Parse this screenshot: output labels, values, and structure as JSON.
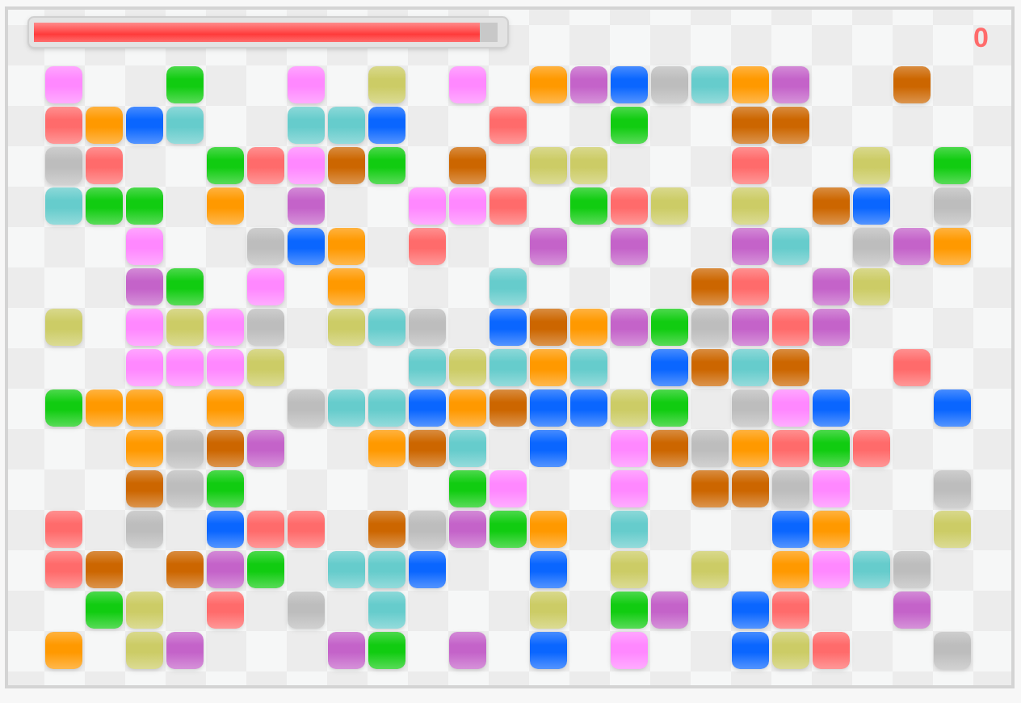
{
  "timer": {
    "level": 0.96
  },
  "score": "0",
  "board": {
    "rows": [
      [
        {
          "color": "#ff88ff"
        },
        null,
        null,
        {
          "color": "#11cc11"
        },
        null,
        null,
        {
          "color": "#ff88ff"
        },
        null,
        {
          "color": "#cccc66"
        },
        null,
        {
          "color": "#ff88ff"
        },
        null,
        {
          "color": "#ff9900"
        },
        {
          "color": "#c463c9"
        },
        {
          "color": "#0a66ff"
        },
        {
          "color": "#bdbdbd"
        },
        {
          "color": "#66cccc"
        },
        {
          "color": "#ff9900"
        },
        {
          "color": "#c463c9"
        },
        null,
        null,
        {
          "color": "#cc6600"
        },
        null
      ],
      [
        {
          "color": "#ff6b6b"
        },
        {
          "color": "#ff9900"
        },
        {
          "color": "#0a66ff"
        },
        {
          "color": "#66cccc"
        },
        null,
        null,
        {
          "color": "#66cccc"
        },
        {
          "color": "#66cccc"
        },
        {
          "color": "#0a66ff"
        },
        null,
        null,
        {
          "color": "#ff6b6b"
        },
        null,
        null,
        {
          "color": "#11cc11"
        },
        null,
        null,
        {
          "color": "#cc6600"
        },
        {
          "color": "#cc6600"
        },
        null,
        null,
        null,
        null
      ],
      [
        {
          "color": "#bdbdbd"
        },
        {
          "color": "#ff6b6b"
        },
        null,
        null,
        {
          "color": "#11cc11"
        },
        {
          "color": "#ff6b6b"
        },
        {
          "color": "#ff88ff"
        },
        {
          "color": "#cc6600"
        },
        {
          "color": "#11cc11"
        },
        null,
        {
          "color": "#cc6600"
        },
        null,
        {
          "color": "#cccc66"
        },
        {
          "color": "#cccc66"
        },
        null,
        null,
        null,
        {
          "color": "#ff6b6b"
        },
        null,
        null,
        {
          "color": "#cccc66"
        },
        null,
        {
          "color": "#11cc11"
        }
      ],
      [
        {
          "color": "#66cccc"
        },
        {
          "color": "#11cc11"
        },
        {
          "color": "#11cc11"
        },
        null,
        {
          "color": "#ff9900"
        },
        null,
        {
          "color": "#c463c9"
        },
        null,
        null,
        {
          "color": "#ff88ff"
        },
        {
          "color": "#ff88ff"
        },
        {
          "color": "#ff6b6b"
        },
        null,
        {
          "color": "#11cc11"
        },
        {
          "color": "#ff6b6b"
        },
        {
          "color": "#cccc66"
        },
        null,
        {
          "color": "#cccc66"
        },
        null,
        {
          "color": "#cc6600"
        },
        {
          "color": "#0a66ff"
        },
        null,
        {
          "color": "#bdbdbd"
        }
      ],
      [
        null,
        null,
        {
          "color": "#ff88ff"
        },
        null,
        null,
        {
          "color": "#bdbdbd"
        },
        {
          "color": "#0a66ff"
        },
        {
          "color": "#ff9900"
        },
        null,
        {
          "color": "#ff6b6b"
        },
        null,
        null,
        {
          "color": "#c463c9"
        },
        null,
        {
          "color": "#c463c9"
        },
        null,
        null,
        {
          "color": "#c463c9"
        },
        {
          "color": "#66cccc"
        },
        null,
        {
          "color": "#bdbdbd"
        },
        {
          "color": "#c463c9"
        },
        {
          "color": "#ff9900"
        }
      ],
      [
        null,
        null,
        {
          "color": "#c463c9"
        },
        {
          "color": "#11cc11"
        },
        null,
        {
          "color": "#ff88ff"
        },
        null,
        {
          "color": "#ff9900"
        },
        null,
        null,
        null,
        {
          "color": "#66cccc"
        },
        null,
        null,
        null,
        null,
        {
          "color": "#cc6600"
        },
        {
          "color": "#ff6b6b"
        },
        null,
        {
          "color": "#c463c9"
        },
        {
          "color": "#cccc66"
        },
        null,
        null
      ],
      [
        {
          "color": "#cccc66"
        },
        null,
        {
          "color": "#ff88ff"
        },
        {
          "color": "#cccc66"
        },
        {
          "color": "#ff88ff"
        },
        {
          "color": "#bdbdbd"
        },
        null,
        {
          "color": "#cccc66"
        },
        {
          "color": "#66cccc"
        },
        {
          "color": "#bdbdbd"
        },
        null,
        {
          "color": "#0a66ff"
        },
        {
          "color": "#cc6600"
        },
        {
          "color": "#ff9900"
        },
        {
          "color": "#c463c9"
        },
        {
          "color": "#11cc11"
        },
        {
          "color": "#bdbdbd"
        },
        {
          "color": "#c463c9"
        },
        {
          "color": "#ff6b6b"
        },
        {
          "color": "#c463c9"
        },
        null,
        null,
        null
      ],
      [
        null,
        null,
        {
          "color": "#ff88ff"
        },
        {
          "color": "#ff88ff"
        },
        {
          "color": "#ff88ff"
        },
        {
          "color": "#cccc66"
        },
        null,
        null,
        null,
        {
          "color": "#66cccc"
        },
        {
          "color": "#cccc66"
        },
        {
          "color": "#66cccc"
        },
        {
          "color": "#ff9900"
        },
        {
          "color": "#66cccc"
        },
        null,
        {
          "color": "#0a66ff"
        },
        {
          "color": "#cc6600"
        },
        {
          "color": "#66cccc"
        },
        {
          "color": "#cc6600"
        },
        null,
        null,
        {
          "color": "#ff6b6b"
        },
        null
      ],
      [
        {
          "color": "#11cc11"
        },
        {
          "color": "#ff9900"
        },
        {
          "color": "#ff9900"
        },
        null,
        {
          "color": "#ff9900"
        },
        null,
        {
          "color": "#bdbdbd"
        },
        {
          "color": "#66cccc"
        },
        {
          "color": "#66cccc"
        },
        {
          "color": "#0a66ff"
        },
        {
          "color": "#ff9900"
        },
        {
          "color": "#cc6600"
        },
        {
          "color": "#0a66ff"
        },
        {
          "color": "#0a66ff"
        },
        {
          "color": "#cccc66"
        },
        {
          "color": "#11cc11"
        },
        null,
        {
          "color": "#bdbdbd"
        },
        {
          "color": "#ff88ff"
        },
        {
          "color": "#0a66ff"
        },
        null,
        null,
        {
          "color": "#0a66ff"
        }
      ],
      [
        null,
        null,
        {
          "color": "#ff9900"
        },
        {
          "color": "#bdbdbd"
        },
        {
          "color": "#cc6600"
        },
        {
          "color": "#c463c9"
        },
        null,
        null,
        {
          "color": "#ff9900"
        },
        {
          "color": "#cc6600"
        },
        {
          "color": "#66cccc"
        },
        null,
        {
          "color": "#0a66ff"
        },
        null,
        {
          "color": "#ff88ff"
        },
        {
          "color": "#cc6600"
        },
        {
          "color": "#bdbdbd"
        },
        {
          "color": "#ff9900"
        },
        {
          "color": "#ff6b6b"
        },
        {
          "color": "#11cc11"
        },
        {
          "color": "#ff6b6b"
        },
        null,
        null
      ],
      [
        null,
        null,
        {
          "color": "#cc6600"
        },
        {
          "color": "#bdbdbd"
        },
        {
          "color": "#11cc11"
        },
        null,
        null,
        null,
        null,
        null,
        {
          "color": "#11cc11"
        },
        {
          "color": "#ff88ff"
        },
        null,
        null,
        {
          "color": "#ff88ff"
        },
        null,
        {
          "color": "#cc6600"
        },
        {
          "color": "#cc6600"
        },
        {
          "color": "#bdbdbd"
        },
        {
          "color": "#ff88ff"
        },
        null,
        null,
        {
          "color": "#bdbdbd"
        }
      ],
      [
        {
          "color": "#ff6b6b"
        },
        null,
        {
          "color": "#bdbdbd"
        },
        null,
        {
          "color": "#0a66ff"
        },
        {
          "color": "#ff6b6b"
        },
        {
          "color": "#ff6b6b"
        },
        null,
        {
          "color": "#cc6600"
        },
        {
          "color": "#bdbdbd"
        },
        {
          "color": "#c463c9"
        },
        {
          "color": "#11cc11"
        },
        {
          "color": "#ff9900"
        },
        null,
        {
          "color": "#66cccc"
        },
        null,
        null,
        null,
        {
          "color": "#0a66ff"
        },
        {
          "color": "#ff9900"
        },
        null,
        null,
        {
          "color": "#cccc66"
        }
      ],
      [
        {
          "color": "#ff6b6b"
        },
        {
          "color": "#cc6600"
        },
        null,
        {
          "color": "#cc6600"
        },
        {
          "color": "#c463c9"
        },
        {
          "color": "#11cc11"
        },
        null,
        {
          "color": "#66cccc"
        },
        {
          "color": "#66cccc"
        },
        {
          "color": "#0a66ff"
        },
        null,
        null,
        {
          "color": "#0a66ff"
        },
        null,
        {
          "color": "#cccc66"
        },
        null,
        {
          "color": "#cccc66"
        },
        null,
        {
          "color": "#ff9900"
        },
        {
          "color": "#ff88ff"
        },
        {
          "color": "#66cccc"
        },
        {
          "color": "#bdbdbd"
        },
        null
      ],
      [
        null,
        {
          "color": "#11cc11"
        },
        {
          "color": "#cccc66"
        },
        null,
        {
          "color": "#ff6b6b"
        },
        null,
        {
          "color": "#bdbdbd"
        },
        null,
        {
          "color": "#66cccc"
        },
        null,
        null,
        null,
        {
          "color": "#cccc66"
        },
        null,
        {
          "color": "#11cc11"
        },
        {
          "color": "#c463c9"
        },
        null,
        {
          "color": "#0a66ff"
        },
        {
          "color": "#ff6b6b"
        },
        null,
        null,
        {
          "color": "#c463c9"
        },
        null
      ],
      [
        {
          "color": "#ff9900"
        },
        null,
        {
          "color": "#cccc66"
        },
        {
          "color": "#c463c9"
        },
        null,
        null,
        null,
        {
          "color": "#c463c9"
        },
        {
          "color": "#11cc11"
        },
        null,
        {
          "color": "#c463c9"
        },
        null,
        {
          "color": "#0a66ff"
        },
        null,
        {
          "color": "#ff88ff"
        },
        null,
        null,
        {
          "color": "#0a66ff"
        },
        {
          "color": "#cccc66"
        },
        {
          "color": "#ff6b6b"
        },
        null,
        null,
        {
          "color": "#bdbdbd"
        }
      ]
    ]
  }
}
